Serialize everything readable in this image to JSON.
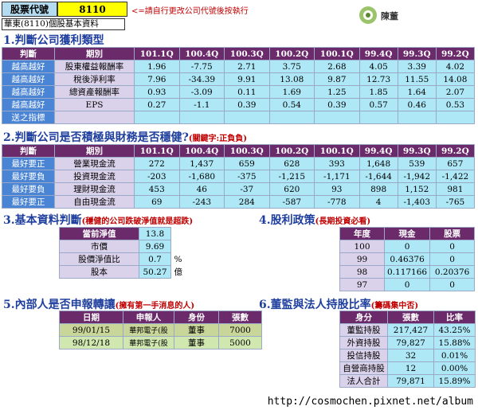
{
  "header": {
    "code_label": "股票代號",
    "code": "8110",
    "hint": "<=請自行更改公司代號後按執行",
    "company_title": "華東(8110)個股基本資料",
    "logo_text": "陳董"
  },
  "s1": {
    "title": "1.判斷公司獲利類型",
    "judge_label": "判斷",
    "period_label": "期別",
    "periods": [
      "101.1Q",
      "100.4Q",
      "100.3Q",
      "100.2Q",
      "100.1Q",
      "99.4Q",
      "99.3Q",
      "99.2Q"
    ],
    "rows": [
      {
        "judge": "越高越好",
        "name": "股東權益報酬率",
        "v": [
          "1.96",
          "-7.75",
          "2.71",
          "3.75",
          "2.68",
          "4.05",
          "3.39",
          "4.02"
        ]
      },
      {
        "judge": "越高越好",
        "name": "稅後淨利率",
        "v": [
          "7.96",
          "-34.39",
          "9.91",
          "13.08",
          "9.87",
          "12.73",
          "11.55",
          "14.08"
        ]
      },
      {
        "judge": "越高越好",
        "name": "總資產報酬率",
        "v": [
          "0.93",
          "-3.09",
          "0.11",
          "1.69",
          "1.25",
          "1.85",
          "1.64",
          "2.07"
        ]
      },
      {
        "judge": "越高越好",
        "name": "EPS",
        "v": [
          "0.27",
          "-1.1",
          "0.39",
          "0.54",
          "0.39",
          "0.57",
          "0.46",
          "0.53"
        ]
      }
    ],
    "footer": "送之指標"
  },
  "s2": {
    "title": "2.判斷公司是否積極與財務是否穩健?",
    "note": "(關鍵字:正負負)",
    "judge_label": "判斷",
    "period_label": "期別",
    "periods": [
      "101.1Q",
      "100.4Q",
      "100.3Q",
      "100.2Q",
      "100.1Q",
      "99.4Q",
      "99.3Q",
      "99.2Q"
    ],
    "rows": [
      {
        "judge": "最好要正",
        "name": "營業現金流",
        "v": [
          "272",
          "1,437",
          "659",
          "628",
          "393",
          "1,648",
          "539",
          "657"
        ]
      },
      {
        "judge": "最好要負",
        "name": "投資現金流",
        "v": [
          "-203",
          "-1,680",
          "-375",
          "-1,215",
          "-1,171",
          "-1,644",
          "-1,942",
          "-1,422"
        ]
      },
      {
        "judge": "最好要負",
        "name": "理財現金流",
        "v": [
          "453",
          "46",
          "-37",
          "620",
          "93",
          "898",
          "1,152",
          "981"
        ]
      },
      {
        "judge": "最好要正",
        "name": "自由現金流",
        "v": [
          "69",
          "-243",
          "284",
          "-587",
          "-778",
          "4",
          "-1,403",
          "-765"
        ]
      }
    ]
  },
  "s3": {
    "title": "3.基本資料判斷",
    "note": "(穩健的公司跌破淨值就是超跌)",
    "rows": [
      {
        "k": "當前淨值",
        "v": "13.8",
        "u": ""
      },
      {
        "k": "市價",
        "v": "9.69",
        "u": ""
      },
      {
        "k": "股價淨值比",
        "v": "0.7",
        "u": "%"
      },
      {
        "k": "股本",
        "v": "50.27",
        "u": "億"
      }
    ]
  },
  "s4": {
    "title": "4.股利政策",
    "note": "(長期投資必看)",
    "headers": [
      "年度",
      "現金",
      "股票"
    ],
    "rows": [
      [
        "100",
        "0",
        "0"
      ],
      [
        "99",
        "0.46376",
        "0"
      ],
      [
        "98",
        "0.117166",
        "0.20376"
      ],
      [
        "97",
        "0",
        "0"
      ]
    ]
  },
  "s5": {
    "title": "5.內部人是否申報轉讓",
    "note": "(擁有第一手消息的人)",
    "headers": [
      "日期",
      "申報人",
      "身份",
      "張數"
    ],
    "rows": [
      [
        "99/01/15",
        "華邦電子(股",
        "董事",
        "7000"
      ],
      [
        "98/12/18",
        "華邦電子(股",
        "董事",
        "5000"
      ]
    ]
  },
  "s6": {
    "title": "6.董監與法人持股比率",
    "note": "(籌碼集中否)",
    "headers": [
      "身分",
      "張數",
      "比率"
    ],
    "rows": [
      [
        "董監持股",
        "217,427",
        "43.25%"
      ],
      [
        "外資持股",
        "79,827",
        "15.88%"
      ],
      [
        "投信持股",
        "32",
        "0.01%"
      ],
      [
        "自營商持股",
        "12",
        "0.00%"
      ],
      [
        "法人合計",
        "79,871",
        "15.89%"
      ]
    ]
  },
  "footer_url": "http://cosmochen.pixnet.net/album"
}
